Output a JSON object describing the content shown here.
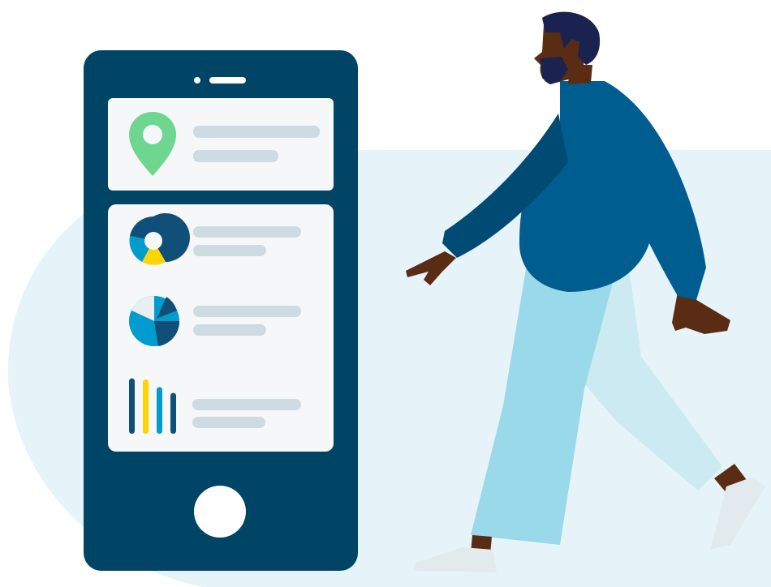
{
  "colors": {
    "background": "#ffffff",
    "backdrop": "#e6f4fa",
    "phone_body": "#004466",
    "card": "#f5f7f9",
    "placeholder_line": "#cfdbe3",
    "pin": "#6fd68f",
    "chart_dark": "#0f4f78",
    "chart_mid": "#009ccd",
    "chart_yellow": "#ffd400",
    "chart_light": "#e8eef2",
    "sweater": "#005d8f",
    "sweater_shadow": "#004b73",
    "pants": "#9ad9ea",
    "pants_light": "#cbeaf2",
    "skin": "#5a2c14",
    "hair": "#1a2350",
    "shoes": "#e3eaee"
  },
  "icons": [
    "map-pin-icon",
    "donut-chart-icon",
    "pie-chart-icon",
    "bar-chart-icon",
    "phone-home-button"
  ],
  "bar_icon_levels": [
    0.95,
    0.93,
    0.8,
    0.7
  ]
}
